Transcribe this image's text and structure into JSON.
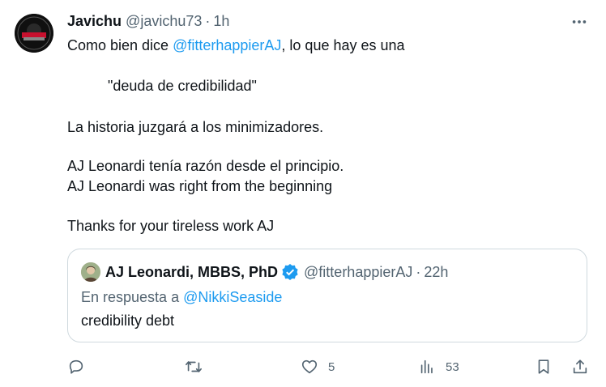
{
  "tweet": {
    "author_name": "Javichu",
    "author_handle": "@javichu73",
    "separator": "·",
    "time": "1h",
    "line1_prefix": "Como bien dice ",
    "line1_mention": "@fitterhappierAJ",
    "line1_suffix": ", lo que hay es una",
    "line2": "\"deuda de credibilidad\"",
    "line3": "La historia juzgará a los minimizadores.",
    "line4": "AJ Leonardi tenía razón desde el principio.",
    "line5": "AJ Leonardi was right from the beginning",
    "line6": "Thanks for your tireless work AJ"
  },
  "quote": {
    "author_name": "AJ Leonardi, MBBS, PhD",
    "author_handle": "@fitterhappierAJ",
    "separator": "·",
    "time": "22h",
    "reply_prefix": "En respuesta a ",
    "reply_mention": "@NikkiSeaside",
    "text": "credibility debt"
  },
  "actions": {
    "likes": "5",
    "views": "53"
  },
  "icons": {
    "more": "more-icon",
    "reply": "reply-icon",
    "repost": "repost-icon",
    "like": "heart-icon",
    "views": "views-icon",
    "bookmark": "bookmark-icon",
    "share": "share-icon",
    "verified": "verified-badge-icon"
  },
  "colors": {
    "accent": "#1d9bf0",
    "secondary_text": "#536471",
    "border": "#cfd9de"
  }
}
